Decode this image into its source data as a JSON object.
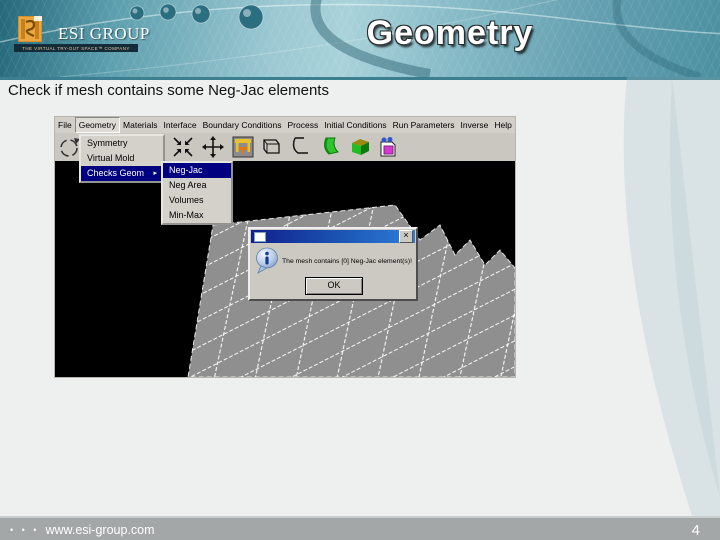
{
  "slide": {
    "title": "Geometry",
    "subtitle": "Check if mesh contains some Neg-Jac elements",
    "page_number": "4",
    "footer": {
      "dots": "• • •",
      "url": "www.esi-group.com"
    },
    "logo": {
      "brand": "ESI GROUP",
      "tagline": "THE VIRTUAL TRY-OUT SPACE™ COMPANY"
    }
  },
  "app": {
    "menubar": {
      "items": [
        "File",
        "Geometry",
        "Materials",
        "Interface",
        "Boundary Conditions",
        "Process",
        "Initial Conditions",
        "Run Parameters",
        "Inverse",
        "Help"
      ],
      "active": "Geometry"
    },
    "geometry_menu": {
      "items": [
        "Symmetry",
        "Virtual Mold",
        "Checks Geom"
      ],
      "highlighted": "Checks Geom",
      "submenu_arrow": "▸"
    },
    "checks_submenu": {
      "items": [
        "Neg-Jac",
        "Neg Area",
        "Volumes",
        "Min-Max"
      ],
      "highlighted": "Neg-Jac"
    },
    "dialog": {
      "message": "The mesh contains [0] Neg-Jac element(s)!",
      "ok": "OK",
      "close": "×"
    }
  },
  "colors": {
    "header_teal_dark": "#24687a",
    "header_teal_light": "#a9d2da",
    "menu_highlight": "#000080",
    "dialog_titlebar_left": "#101f8c",
    "dialog_titlebar_right": "#2f7cd8",
    "viewport": "#000000",
    "mesh_gray": "#8f8f8f",
    "footer_gray": "#a3a7a7",
    "logo_orange": "#eaa73e"
  }
}
